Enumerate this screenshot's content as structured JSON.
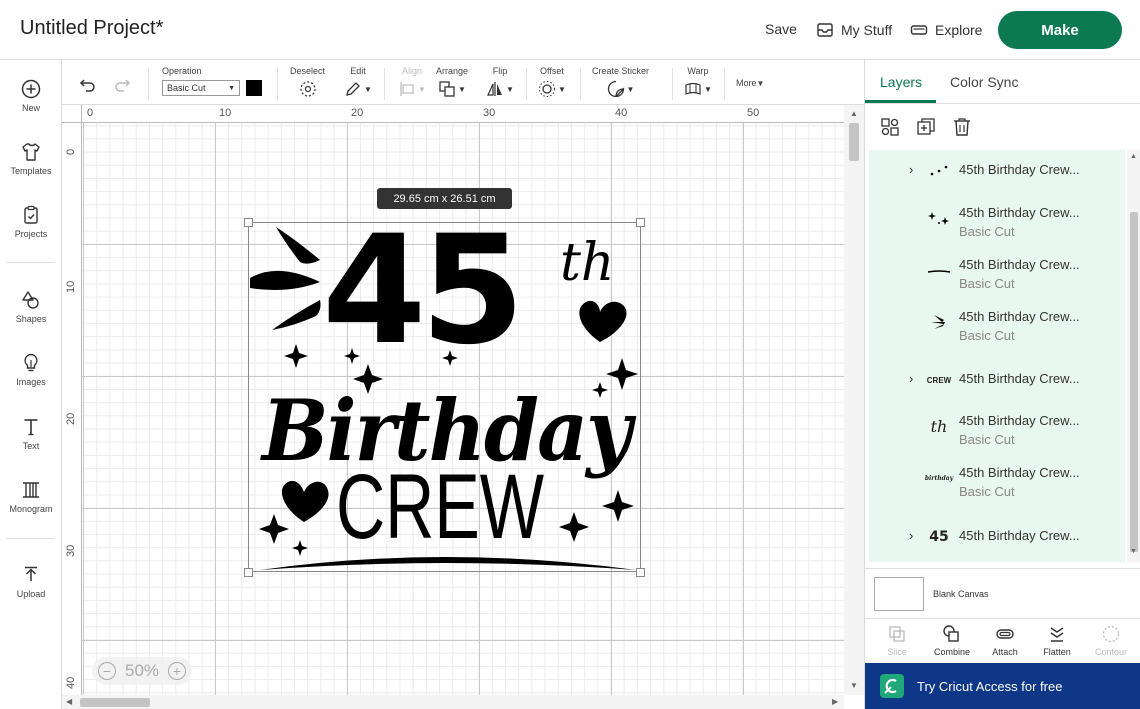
{
  "header": {
    "title": "Untitled Project*",
    "save_label": "Save",
    "my_stuff_label": "My Stuff",
    "explore_label": "Explore",
    "make_label": "Make",
    "accent": "#0b7a52"
  },
  "sidebar": {
    "items": [
      {
        "label": "New",
        "icon": "plus-circle-icon"
      },
      {
        "label": "Templates",
        "icon": "shirt-icon"
      },
      {
        "label": "Projects",
        "icon": "clipboard-icon"
      },
      {
        "label": "Shapes",
        "icon": "shapes-icon"
      },
      {
        "label": "Images",
        "icon": "bulb-icon"
      },
      {
        "label": "Text",
        "icon": "text-icon"
      },
      {
        "label": "Monogram",
        "icon": "monogram-icon"
      },
      {
        "label": "Upload",
        "icon": "upload-icon"
      }
    ]
  },
  "toolbar": {
    "operation_label": "Operation",
    "operation_value": "Basic Cut",
    "operation_color": "#000000",
    "deselect_label": "Deselect",
    "edit_label": "Edit",
    "align_label": "Align",
    "arrange_label": "Arrange",
    "flip_label": "Flip",
    "offset_label": "Offset",
    "create_sticker_label": "Create Sticker",
    "warp_label": "Warp",
    "more_label": "More"
  },
  "canvas": {
    "ruler_top": [
      "0",
      "10",
      "20",
      "30",
      "40",
      "50"
    ],
    "ruler_left": [
      "0",
      "10",
      "20",
      "30",
      "40"
    ],
    "size_tooltip": "29.65  cm x 26.51  cm",
    "zoom_level": "50%",
    "design": {
      "number": "45",
      "suffix": "th",
      "word1": "Birthday",
      "word2": "CREW"
    }
  },
  "panel": {
    "tabs": [
      "Layers",
      "Color Sync"
    ],
    "active_tab": "Layers",
    "layers": [
      {
        "name": "45th Birthday Crew...",
        "sub": "",
        "expandable": true,
        "thumb": "dots"
      },
      {
        "name": "45th Birthday Crew...",
        "sub": "Basic Cut",
        "expandable": false,
        "thumb": "sparkles"
      },
      {
        "name": "45th Birthday Crew...",
        "sub": "Basic Cut",
        "expandable": false,
        "thumb": "line"
      },
      {
        "name": "45th Birthday Crew...",
        "sub": "Basic Cut",
        "expandable": false,
        "thumb": "rays"
      },
      {
        "name": "45th Birthday Crew...",
        "sub": "",
        "expandable": true,
        "thumb": "CREW"
      },
      {
        "name": "45th Birthday Crew...",
        "sub": "Basic Cut",
        "expandable": false,
        "thumb": "th"
      },
      {
        "name": "45th Birthday Crew...",
        "sub": "Basic Cut",
        "expandable": false,
        "thumb": "birthday"
      },
      {
        "name": "45th Birthday Crew...",
        "sub": "",
        "expandable": true,
        "thumb": "45"
      }
    ],
    "blank_canvas_label": "Blank Canvas",
    "actions": [
      {
        "label": "Slice",
        "enabled": false
      },
      {
        "label": "Combine",
        "enabled": true
      },
      {
        "label": "Attach",
        "enabled": true
      },
      {
        "label": "Flatten",
        "enabled": true
      },
      {
        "label": "Contour",
        "enabled": false
      }
    ],
    "access_banner": "Try Cricut Access for free",
    "layer_bg": "#e8f7f0",
    "banner_bg": "#0f3787"
  }
}
